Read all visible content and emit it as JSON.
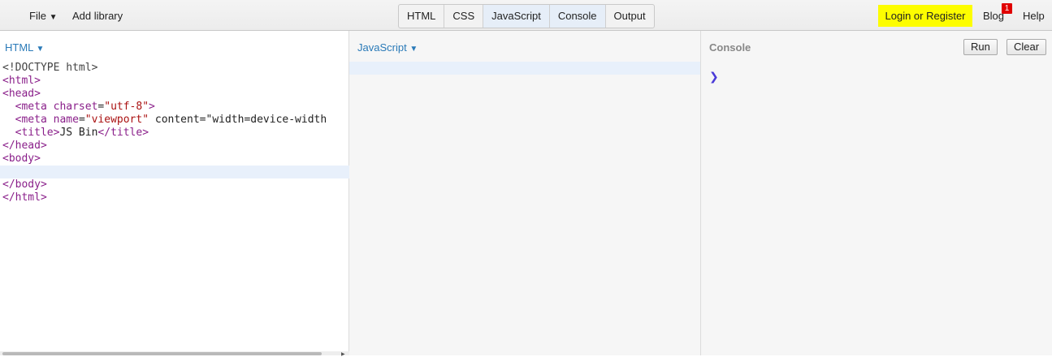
{
  "menu": {
    "file_label": "File",
    "file_caret": "▼",
    "add_library_label": "Add library"
  },
  "tabs": [
    {
      "label": "HTML",
      "active": false
    },
    {
      "label": "CSS",
      "active": false
    },
    {
      "label": "JavaScript",
      "active": true
    },
    {
      "label": "Console",
      "active": true
    },
    {
      "label": "Output",
      "active": false
    }
  ],
  "right": {
    "login_label": "Login or Register",
    "blog_label": "Blog",
    "blog_badge": "1",
    "help_label": "Help"
  },
  "html_panel": {
    "label": "HTML",
    "caret": "▼",
    "code_lines": [
      "<!DOCTYPE html>",
      "<html>",
      "<head>",
      "  <meta charset=\"utf-8\">",
      "  <meta name=\"viewport\" content=\"width=device-width",
      "  <title>JS Bin</title>",
      "</head>",
      "<body>",
      "",
      "</body>",
      "</html>"
    ],
    "highlighted_line": 9
  },
  "js_panel": {
    "label": "JavaScript",
    "caret": "▼"
  },
  "console_panel": {
    "label": "Console",
    "run_label": "Run",
    "clear_label": "Clear",
    "prompt": "❯"
  },
  "colors": {
    "login_bg": "#fdfd00",
    "badge_bg": "#e00000",
    "panel_label": "#2a7ab8",
    "tag": "#8a1f8a",
    "string": "#aa1111",
    "prompt": "#4a3ad8"
  }
}
